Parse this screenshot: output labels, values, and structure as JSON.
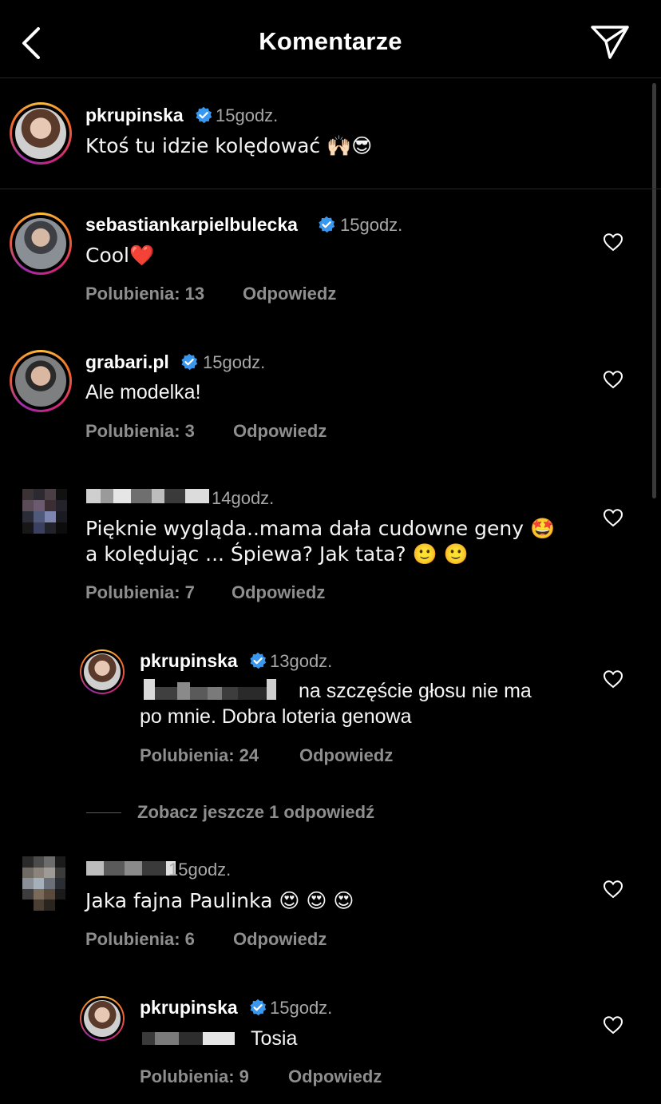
{
  "header": {
    "title": "Komentarze",
    "back_icon": "chevron-left-icon",
    "send_icon": "paper-plane-icon"
  },
  "caption": {
    "username": "pkrupinska",
    "verified": true,
    "time": "15godz.",
    "text": "Ktoś tu idzie kolędować 🙌🏻😎"
  },
  "comments": [
    {
      "username": "sebastiankarpielbulecka",
      "verified": true,
      "time": "15godz.",
      "text": "Cool❤️",
      "likes": "Polubienia: 13",
      "reply": "Odpowiedz"
    },
    {
      "username": "grabari.pl",
      "verified": true,
      "time": "15godz.",
      "text": "Ale modelka!",
      "likes": "Polubienia: 3",
      "reply": "Odpowiedz"
    },
    {
      "username": "",
      "verified": false,
      "time": "14godz.",
      "text_line1": "Pięknie wygląda..mama dała cudowne geny 🤩",
      "text_line2": "a kolędując ... Śpiewa? Jak tata? 🙂 🙂",
      "likes": "Polubienia: 7",
      "reply": "Odpowiedz",
      "replies": [
        {
          "username": "pkrupinska",
          "verified": true,
          "time": "13godz.",
          "text_line1": "na szczęście głosu nie ma",
          "text_line2": "po mnie. Dobra loteria genowa",
          "likes": "Polubienia: 24",
          "reply": "Odpowiedz"
        }
      ],
      "more_replies": "Zobacz jeszcze 1 odpowiedź"
    },
    {
      "username": "",
      "verified": false,
      "time": "15godz.",
      "text": "Jaka fajna Paulinka 😍 😍 😍",
      "likes": "Polubienia: 6",
      "reply": "Odpowiedz",
      "replies": [
        {
          "username": "pkrupinska",
          "verified": true,
          "time": "15godz.",
          "text": "Tosia",
          "likes": "Polubienia: 9",
          "reply": "Odpowiedz"
        }
      ]
    }
  ],
  "colors": {
    "background": "#000000",
    "text": "#ffffff",
    "muted": "#8e8e8e",
    "verified": "#3897f0"
  }
}
